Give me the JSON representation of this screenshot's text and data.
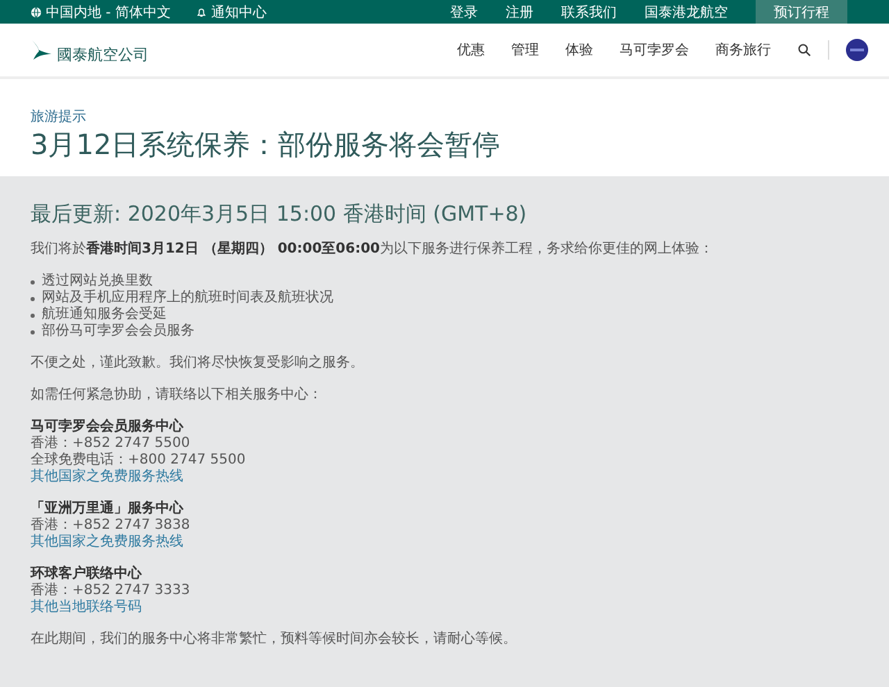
{
  "top_bar": {
    "region": "中国内地 - 简体中文",
    "notifications": "通知中心",
    "links": [
      "登录",
      "注册",
      "联系我们",
      "国泰港龙航空"
    ],
    "book_button": "预订行程"
  },
  "nav": {
    "logo_text": "國泰航空公司",
    "items": [
      "优惠",
      "管理",
      "体验",
      "马可孛罗会",
      "商务旅行"
    ]
  },
  "breadcrumb": "旅游提示",
  "title": "3月12日系统保养：部份服务将会暂停",
  "updated": "最后更新: 2020年3月5日 15:00 香港时间 (GMT+8)",
  "intro": "我们将於**香港时间3月12日 （星期四） 00:00至06:00**为以下服务进行保养工程，务求给你更佳的网上体验：",
  "bullets": [
    "透过网站兑换里数",
    "网站及手机应用程序上的航班时间表及航班状况",
    "航班通知服务会受延",
    "部份马可孛罗会会员服务"
  ],
  "paragraphs": [
    "不便之处，谨此致歉。我们将尽快恢复受影响之服务。",
    "如需任何紧急协助，请联络以下相关服务中心："
  ],
  "contacts": [
    {
      "name": "马可孛罗会会员服务中心",
      "lines": [
        "香港：+852 2747 5500",
        "全球免费电话：+800 2747 5500"
      ],
      "link": "其他国家之免费服务热线"
    },
    {
      "name": "「亚洲万里通」服务中心",
      "lines": [
        "香港：+852 2747 3838"
      ],
      "link": "其他国家之免费服务热线"
    },
    {
      "name": "环球客户联络中心",
      "lines": [
        "香港：+852 2747 3333"
      ],
      "link": "其他当地联络号码"
    }
  ],
  "closing": "在此期间，我们的服务中心将非常繁忙，预料等候时间亦会较长，请耐心等候。"
}
